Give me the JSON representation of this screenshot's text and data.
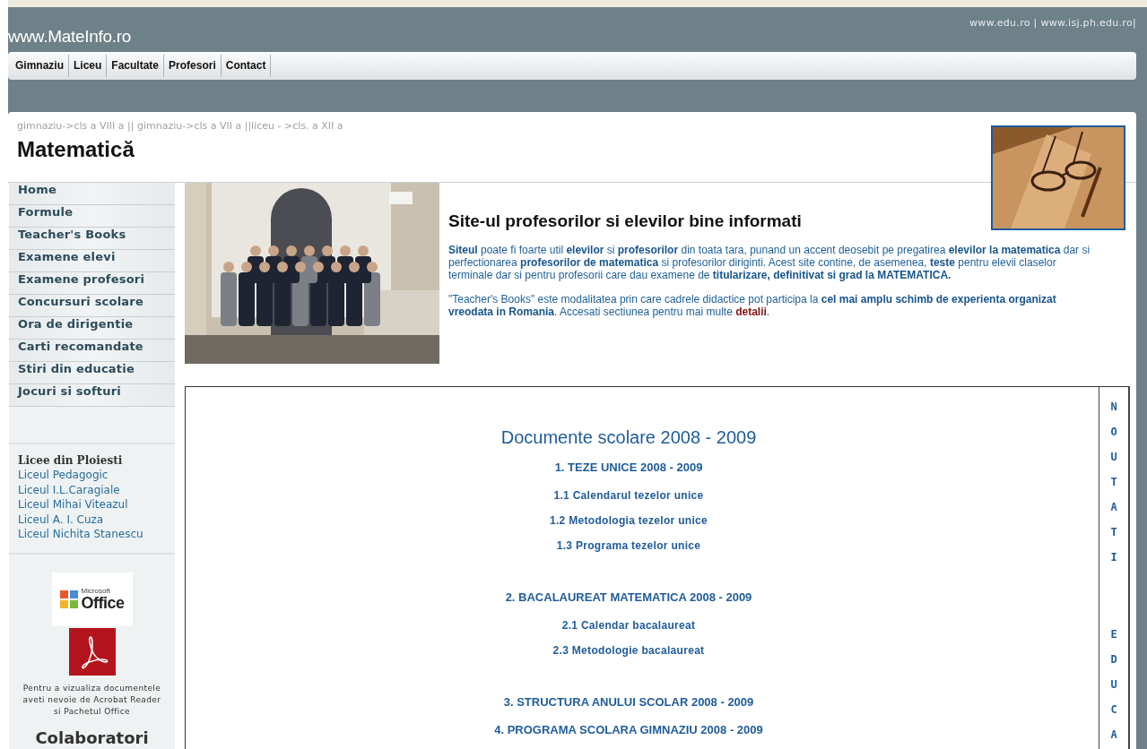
{
  "header": {
    "site_title": "www.MateInfo.ro",
    "top_links": "www.edu.ro | www.isj.ph.edu.ro|",
    "nav": [
      {
        "label": "Gimnaziu"
      },
      {
        "label": "Liceu"
      },
      {
        "label": "Facultate"
      },
      {
        "label": "Profesori"
      },
      {
        "label": "Contact"
      }
    ]
  },
  "breadcrumb": "gimnaziu->cls a VIII a || gimnaziu->cls a VII a ||liceu - >cls. a XII a",
  "page_title": "Matematică",
  "sidebar": {
    "menu": [
      "Home",
      "Formule",
      "Teacher's Books",
      "Examene elevi",
      "Examene profesori",
      "Concursuri scolare",
      "Ora de dirigentie",
      "Carti recomandate",
      "Stiri din educatie",
      "Jocuri si softuri"
    ],
    "schools": {
      "heading": "Licee din Ploiesti",
      "items": [
        "Liceul Pedagogic",
        "Liceul I.L.Caragiale",
        "Liceul Mihai Viteazul",
        "Liceul A. I. Cuza",
        "Liceul Nichita Stanescu"
      ]
    },
    "office_logo": {
      "small": "Microsoft",
      "big": "Office"
    },
    "note": "Pentru a vizualiza documentele aveti nevoie de Acrobat Reader si Pachetul Office",
    "collaborators": "Colaboratori"
  },
  "intro": {
    "heading": "Site-ul profesorilor si elevilor bine informati",
    "paragraph_1": "**Siteul** poate fi foarte util **elevilor** si **profesorilor** din toata tara, punand un accent deosebit pe pregatirea **elevilor la matematica** dar si perfectionarea **profesorilor de matematica** si profesorilor diriginti. Acest site contine, de asemenea, **teste** pentru elevii claselor terminale dar si pentru profesorii care dau examene de **titularizare, definitivat si grad la MATEMATICA.**",
    "paragraph_2": "\"Teacher's Books\" este modalitatea prin care cadrele didactice pot participa la **cel mai amplu schimb de experienta organizat vreodata in Romania**. Accesati sectiunea pentru mai multe",
    "link": "detalii",
    "link_after": "."
  },
  "documents": {
    "title": "Documente scolare 2008 - 2009",
    "sections": [
      {
        "title": "1. TEZE UNICE 2008 - 2009",
        "items": [
          "1.1 Calendarul tezelor unice",
          "1.2 Metodologia tezelor unice",
          "1.3 Programa tezelor unice"
        ]
      },
      {
        "title": "2. BACALAUREAT MATEMATICA 2008 - 2009",
        "items": [
          "2.1 Calendar bacalaureat",
          "2.3 Metodologie bacalaureat"
        ]
      },
      {
        "title": "3. STRUCTURA ANULUI SCOLAR 2008 - 2009"
      },
      {
        "title": "4. PROGRAMA SCOLARA GIMNAZIU 2008 - 2009"
      }
    ]
  },
  "side_column": [
    "NOUTATI",
    "EDUCA"
  ]
}
